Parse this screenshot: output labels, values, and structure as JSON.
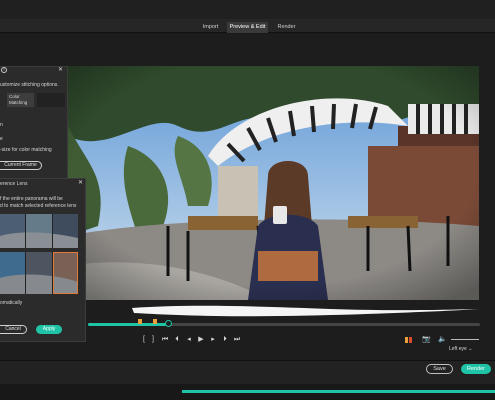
{
  "tabs": [
    {
      "label": "Import",
      "active": false
    },
    {
      "label": "Preview & Edit",
      "active": true
    },
    {
      "label": "Render",
      "active": false
    }
  ],
  "dialog": {
    "intro": "ustomize stitching options.",
    "tab_color_matching": "Color Matching",
    "partial_line_1": "n",
    "partial_line_2": "e",
    "size_note": "-size for color matching",
    "current_frame_button": "Current Frame",
    "ref_lens_title": "erence Lens",
    "ref_desc_1": "f the entire panorama will be",
    "ref_desc_2": "d to match selected reference lens",
    "auto_label": "omatically",
    "cancel_label": "Cancel",
    "apply_label": "Apply"
  },
  "playback": {
    "view_mode": "Left eye",
    "view_mode_caret": "⌄"
  },
  "bottom": {
    "save_label": "Save",
    "render_label": "Render"
  },
  "icons": {
    "help": "help-icon",
    "close": "close-icon",
    "camera": "camera-icon",
    "volume": "volume-icon"
  },
  "colors": {
    "accent": "#1fc4a7",
    "marker": "#e9a23b",
    "selection": "#e27a3a"
  },
  "timeline": {
    "progress": 0.2
  }
}
